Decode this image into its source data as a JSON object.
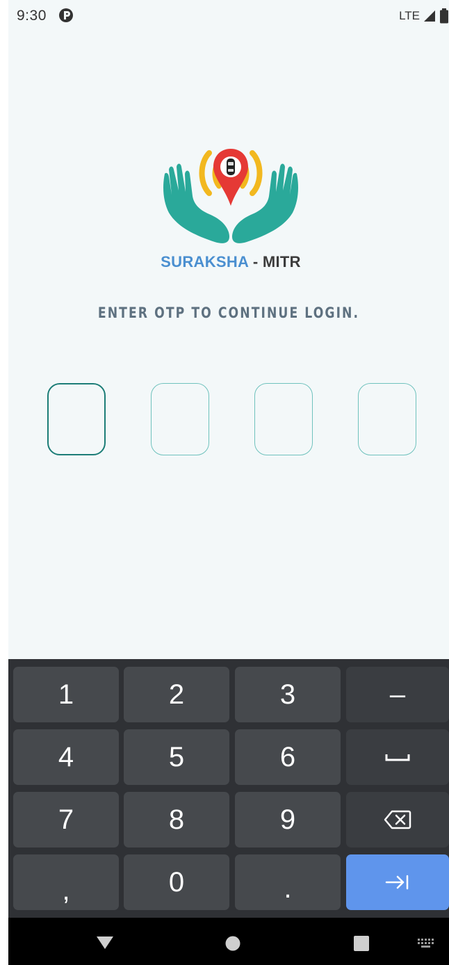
{
  "status_bar": {
    "time": "9:30",
    "network": "LTE",
    "app_icon": "notification-app-icon",
    "signal_icon": "cell-signal-icon",
    "battery_icon": "battery-icon"
  },
  "logo": {
    "name_part_1": "SURAKSHA",
    "name_part_2": " - MITR",
    "icon": "hands-location-pin-logo",
    "colors": {
      "hands": "#2aa99a",
      "signal": "#f2b81f",
      "pin": "#e53935",
      "text_primary": "#4a8fd0",
      "text_secondary": "#3c3c3c"
    }
  },
  "prompt": "ENTER OTP TO CONTINUE LOGIN.",
  "otp": {
    "digits": [
      "",
      "",
      "",
      ""
    ],
    "focused_index": 0
  },
  "keyboard": {
    "rows": [
      [
        "1",
        "2",
        "3",
        "–"
      ],
      [
        "4",
        "5",
        "6",
        "space-icon"
      ],
      [
        "7",
        "8",
        "9",
        "backspace-icon"
      ],
      [
        ",",
        "0",
        ".",
        "next-icon"
      ]
    ],
    "key_labels": {
      "k1": "1",
      "k2": "2",
      "k3": "3",
      "dash": "–",
      "k4": "4",
      "k5": "5",
      "k6": "6",
      "k7": "7",
      "k8": "8",
      "k9": "9",
      "comma": ",",
      "k0": "0",
      "period": "."
    },
    "action_color": "#5f95ec"
  },
  "nav_bar": {
    "back": "back-triangle-icon",
    "home": "home-circle-icon",
    "recents": "recents-square-icon",
    "keyboard": "keyboard-switch-icon"
  }
}
